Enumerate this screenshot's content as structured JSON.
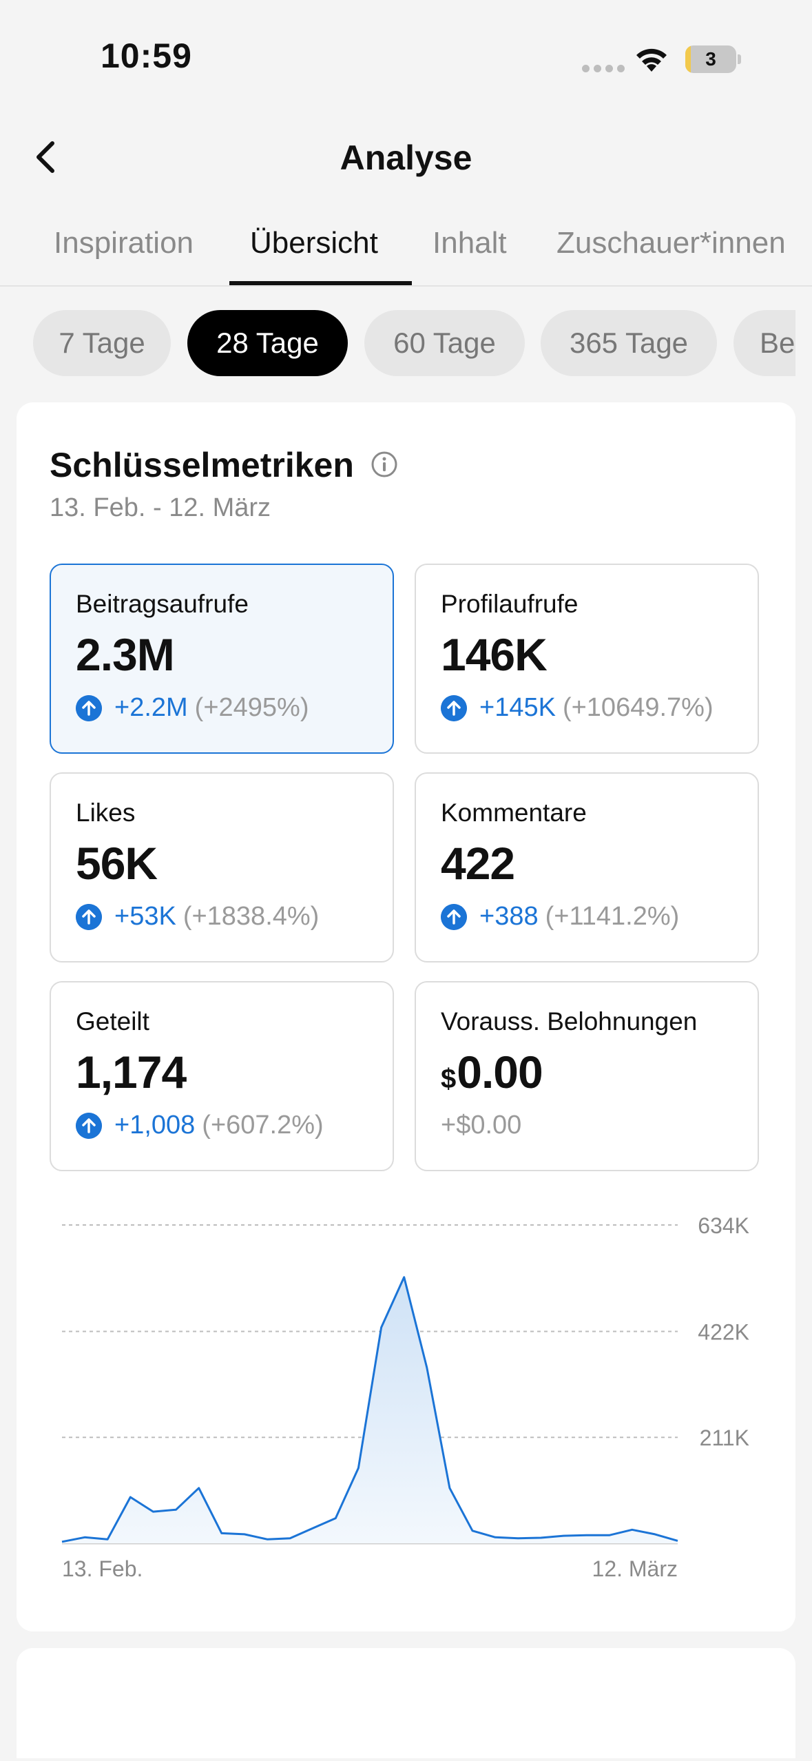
{
  "status_bar": {
    "time": "10:59",
    "battery": "3"
  },
  "nav": {
    "title": "Analyse",
    "back_icon": "chevron-left-icon"
  },
  "tabs": [
    {
      "label": "Inspiration",
      "active": false
    },
    {
      "label": "Übersicht",
      "active": true
    },
    {
      "label": "Inhalt",
      "active": false
    },
    {
      "label": "Zuschauer*innen",
      "active": false
    }
  ],
  "ranges": [
    {
      "label": "7 Tage",
      "active": false
    },
    {
      "label": "28 Tage",
      "active": true
    },
    {
      "label": "60 Tage",
      "active": false
    },
    {
      "label": "365 Tage",
      "active": false
    },
    {
      "label": "Be",
      "active": false
    }
  ],
  "key_metrics": {
    "title": "Schlüsselmetriken",
    "date_range": "13. Feb. - 12. März",
    "cards": [
      {
        "label": "Beitragsaufrufe",
        "value": "2.3M",
        "delta": "+2.2M",
        "pct": "(+2495%)",
        "selected": true
      },
      {
        "label": "Profilaufrufe",
        "value": "146K",
        "delta": "+145K",
        "pct": "(+10649.7%)"
      },
      {
        "label": "Likes",
        "value": "56K",
        "delta": "+53K",
        "pct": "(+1838.4%)"
      },
      {
        "label": "Kommentare",
        "value": "422",
        "delta": "+388",
        "pct": "(+1141.2%)"
      },
      {
        "label": "Geteilt",
        "value": "1,174",
        "delta": "+1,008",
        "pct": "(+607.2%)"
      },
      {
        "label": "Vorauss. Belohnungen",
        "currency": "$",
        "value": "0.00",
        "change": "+$0.00"
      }
    ]
  },
  "colors": {
    "accent": "#1b74d6",
    "muted": "#9a9a9a",
    "fill": "#dbe9f8"
  },
  "chart_data": {
    "type": "area",
    "metric": "Beitragsaufrufe",
    "y_ticks": [
      "634K",
      "422K",
      "211K"
    ],
    "ylim": [
      0,
      634000
    ],
    "x_labels": {
      "start": "13. Feb.",
      "end": "12. März"
    },
    "values": [
      3000,
      12000,
      8000,
      92000,
      63000,
      67000,
      110000,
      20000,
      18000,
      8000,
      10000,
      30000,
      50000,
      150000,
      430000,
      530000,
      350000,
      110000,
      25000,
      12000,
      10000,
      11000,
      15000,
      16000,
      16000,
      27000,
      18000,
      5000
    ]
  },
  "section2": {}
}
